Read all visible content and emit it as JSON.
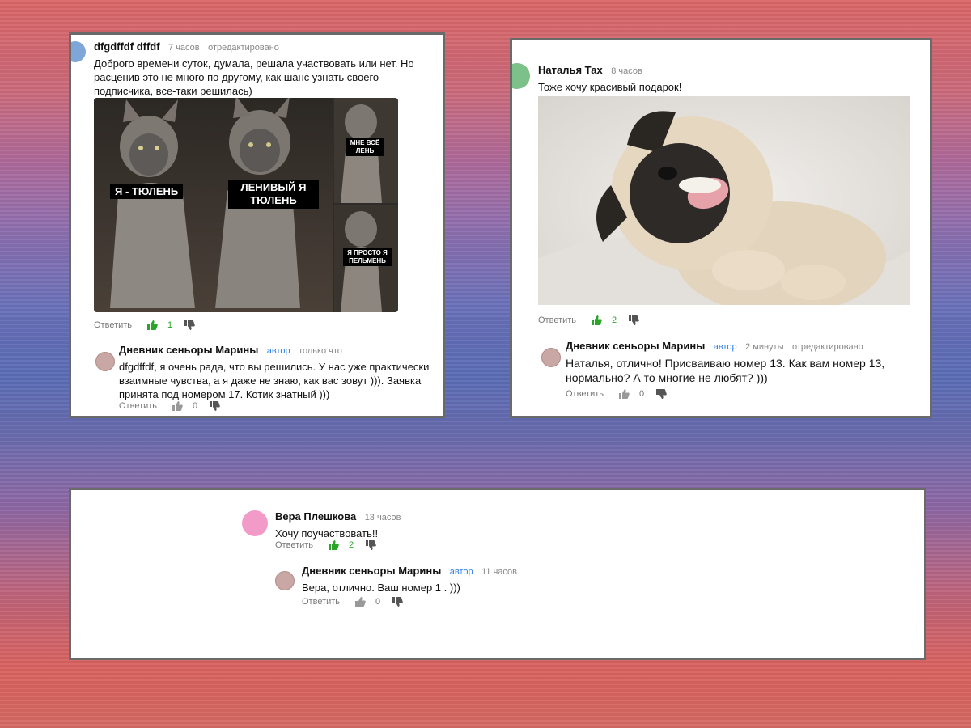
{
  "panel1": {
    "comment": {
      "author": "dfgdffdf dffdf",
      "time": "7 часов",
      "edited": "отредактировано",
      "text": "Доброго времени суток, думала, решала участвовать или нет. Но расценив это не много по другому, как шанс узнать своего подписчика, все-таки решилась)",
      "image_captions": [
        "Я - ТЮЛЕНЬ",
        "ЛЕНИВЫЙ Я ТЮЛЕНЬ",
        "МНЕ ВСЁ ЛЕНЬ",
        "Я ПРОСТО Я ПЕЛЬМЕНЬ"
      ],
      "reply_label": "Ответить",
      "likes": "1"
    },
    "reply": {
      "author": "Дневник сеньоры Марины",
      "badge": "автор",
      "time": "только что",
      "text": "dfgdffdf, я очень рада, что вы решились. У нас уже практически взаимные чувства, а я даже не знаю, как вас зовут ))). Заявка принята под номером 17. Котик знатный )))",
      "reply_label": "Ответить",
      "likes": "0"
    }
  },
  "panel2": {
    "comment": {
      "author": "Наталья Тах",
      "time": "8 часов",
      "text": "Тоже хочу красивый подарок!",
      "reply_label": "Ответить",
      "likes": "2"
    },
    "reply": {
      "author": "Дневник сеньоры Марины",
      "badge": "автор",
      "time": "2 минуты",
      "edited": "отредактировано",
      "text": "Наталья, отлично! Присваиваю номер 13. Как вам номер 13, нормально? А то многие не любят? )))",
      "reply_label": "Ответить",
      "likes": "0"
    }
  },
  "panel3": {
    "comment": {
      "author": "Вера Плешкова",
      "time": "13 часов",
      "text": "Хочу поучаствовать!!",
      "reply_label": "Ответить",
      "likes": "2"
    },
    "reply": {
      "author": "Дневник сеньоры Марины",
      "badge": "автор",
      "time": "11 часов",
      "text": "Вера, отлично. Ваш номер 1 . )))",
      "reply_label": "Ответить",
      "likes": "0"
    }
  },
  "colors": {
    "like_active": "#2aa52a",
    "author_badge": "#2f80ed"
  }
}
